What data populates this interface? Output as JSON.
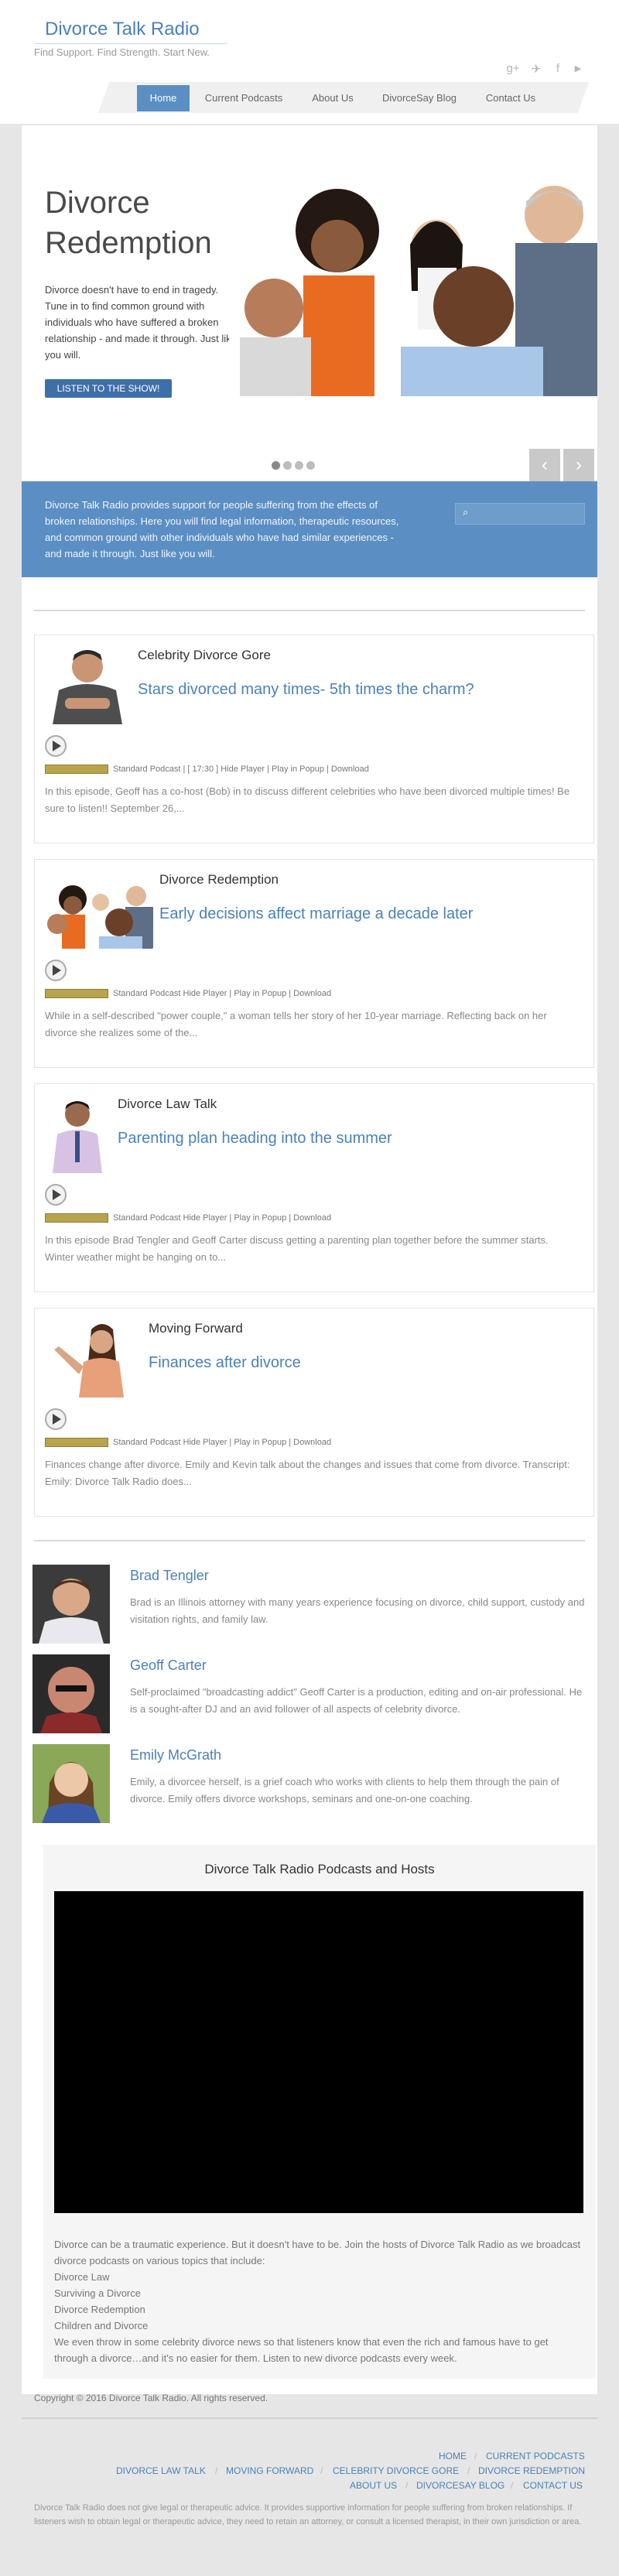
{
  "header": {
    "site_title": "Divorce Talk Radio",
    "tagline": "Find Support. Find Strength. Start New.",
    "social_icons": [
      "google-plus-icon",
      "twitter-icon",
      "facebook-icon",
      "youtube-icon"
    ],
    "social_glyphs": [
      "g+",
      "✈",
      "f",
      "▶"
    ]
  },
  "nav": {
    "items": [
      {
        "label": "Home"
      },
      {
        "label": "Current Podcasts"
      },
      {
        "label": "About Us"
      },
      {
        "label": "DivorceSay Blog"
      },
      {
        "label": "Contact Us"
      }
    ]
  },
  "slider": {
    "title": "Divorce Redemption",
    "text": "Divorce doesn't have to end in tragedy. Tune in to find common ground with individuals who have suffered a broken relationship - and made it through. Just like you will.",
    "button": "LISTEN TO THE SHOW!",
    "prev_arrow": "‹",
    "next_arrow": "›"
  },
  "band": {
    "text": "Divorce Talk Radio provides support for people suffering from the effects of broken relationships. Here you will find legal information, therapeutic resources, and common ground with other individuals who have had similar experiences - and made it through. Just like you will."
  },
  "posts": [
    {
      "show": "Celebrity Divorce Gore",
      "title": "Stars divorced many times- 5th times the charm?",
      "meta": "Standard Podcast | [ 17:30 ] Hide Player | Play in Popup | Download",
      "excerpt": "In this episode, Geoff has a co-host (Bob) in to discuss different celebrities who have been divorced multiple times! Be sure to listen!! September 26,..."
    },
    {
      "show": "Divorce Redemption",
      "title": "Early decisions affect marriage a decade later",
      "meta": "Standard Podcast Hide Player | Play in Popup | Download",
      "excerpt": "While in a self-described \"power couple,\" a woman tells her story of her 10-year marriage. Reflecting back on her divorce she realizes some of the..."
    },
    {
      "show": "Divorce Law Talk",
      "title": "Parenting plan heading into the summer",
      "meta": "Standard Podcast Hide Player | Play in Popup | Download",
      "excerpt": "In this episode Brad Tengler and Geoff Carter discuss getting a parenting plan together before the summer starts. Winter weather might be hanging on to..."
    },
    {
      "show": "Moving Forward",
      "title": "Finances after divorce",
      "meta": "Standard Podcast Hide Player | Play in Popup | Download",
      "excerpt": "Finances change after divorce. Emily and Kevin talk about the changes and issues that come from divorce. Transcript:   Emily: Divorce Talk Radio does..."
    }
  ],
  "hosts": [
    {
      "name": "Brad Tengler",
      "bio": "Brad is an Illinois attorney with many years experience focusing on divorce, child support, custody and visitation rights, and family law."
    },
    {
      "name": "Geoff Carter",
      "bio": "Self-proclaimed \"broadcasting addict\" Geoff Carter is a production, editing and on-air professional. He is a sought-after DJ and an avid follower of all aspects of celebrity divorce."
    },
    {
      "name": "Emily McGrath",
      "bio": "Emily, a divorcee herself, is a grief coach who works with clients to help them through the pain of divorce. Emily offers divorce workshops, seminars and one-on-one coaching."
    }
  ],
  "video_section": {
    "title": "Divorce Talk Radio Podcasts and Hosts",
    "intro": "Divorce can be a traumatic experience. But it doesn't have to be. Join the hosts of Divorce Talk Radio as we broadcast divorce podcasts on various topics that include:",
    "topics": [
      "Divorce Law",
      "Surviving a Divorce",
      "Divorce Redemption",
      "Children and Divorce"
    ],
    "outro": "We even throw in some celebrity divorce news so that listeners know that even the rich and famous have to get through a divorce…and it's no easier for them. Listen to new divorce podcasts every week."
  },
  "footer": {
    "copyright": "Copyright © 2016 Divorce Talk Radio. All rights reserved.",
    "row1": [
      "HOME",
      "CURRENT PODCASTS"
    ],
    "row2": [
      "DIVORCE LAW TALK",
      "MOVING FORWARD",
      "CELEBRITY DIVORCE GORE",
      "DIVORCE REDEMPTION"
    ],
    "row3": [
      "ABOUT US",
      "DIVORCESAY BLOG",
      "CONTACT US"
    ],
    "disclaimer": "Divorce Talk Radio does not give legal or therapeutic advice. It provides supportive information for people suffering from broken relationships. If listeners wish to obtain legal or therapeutic advice, they need to retain an attorney, or consult a licensed therapist, in their own jurisdiction or area."
  }
}
